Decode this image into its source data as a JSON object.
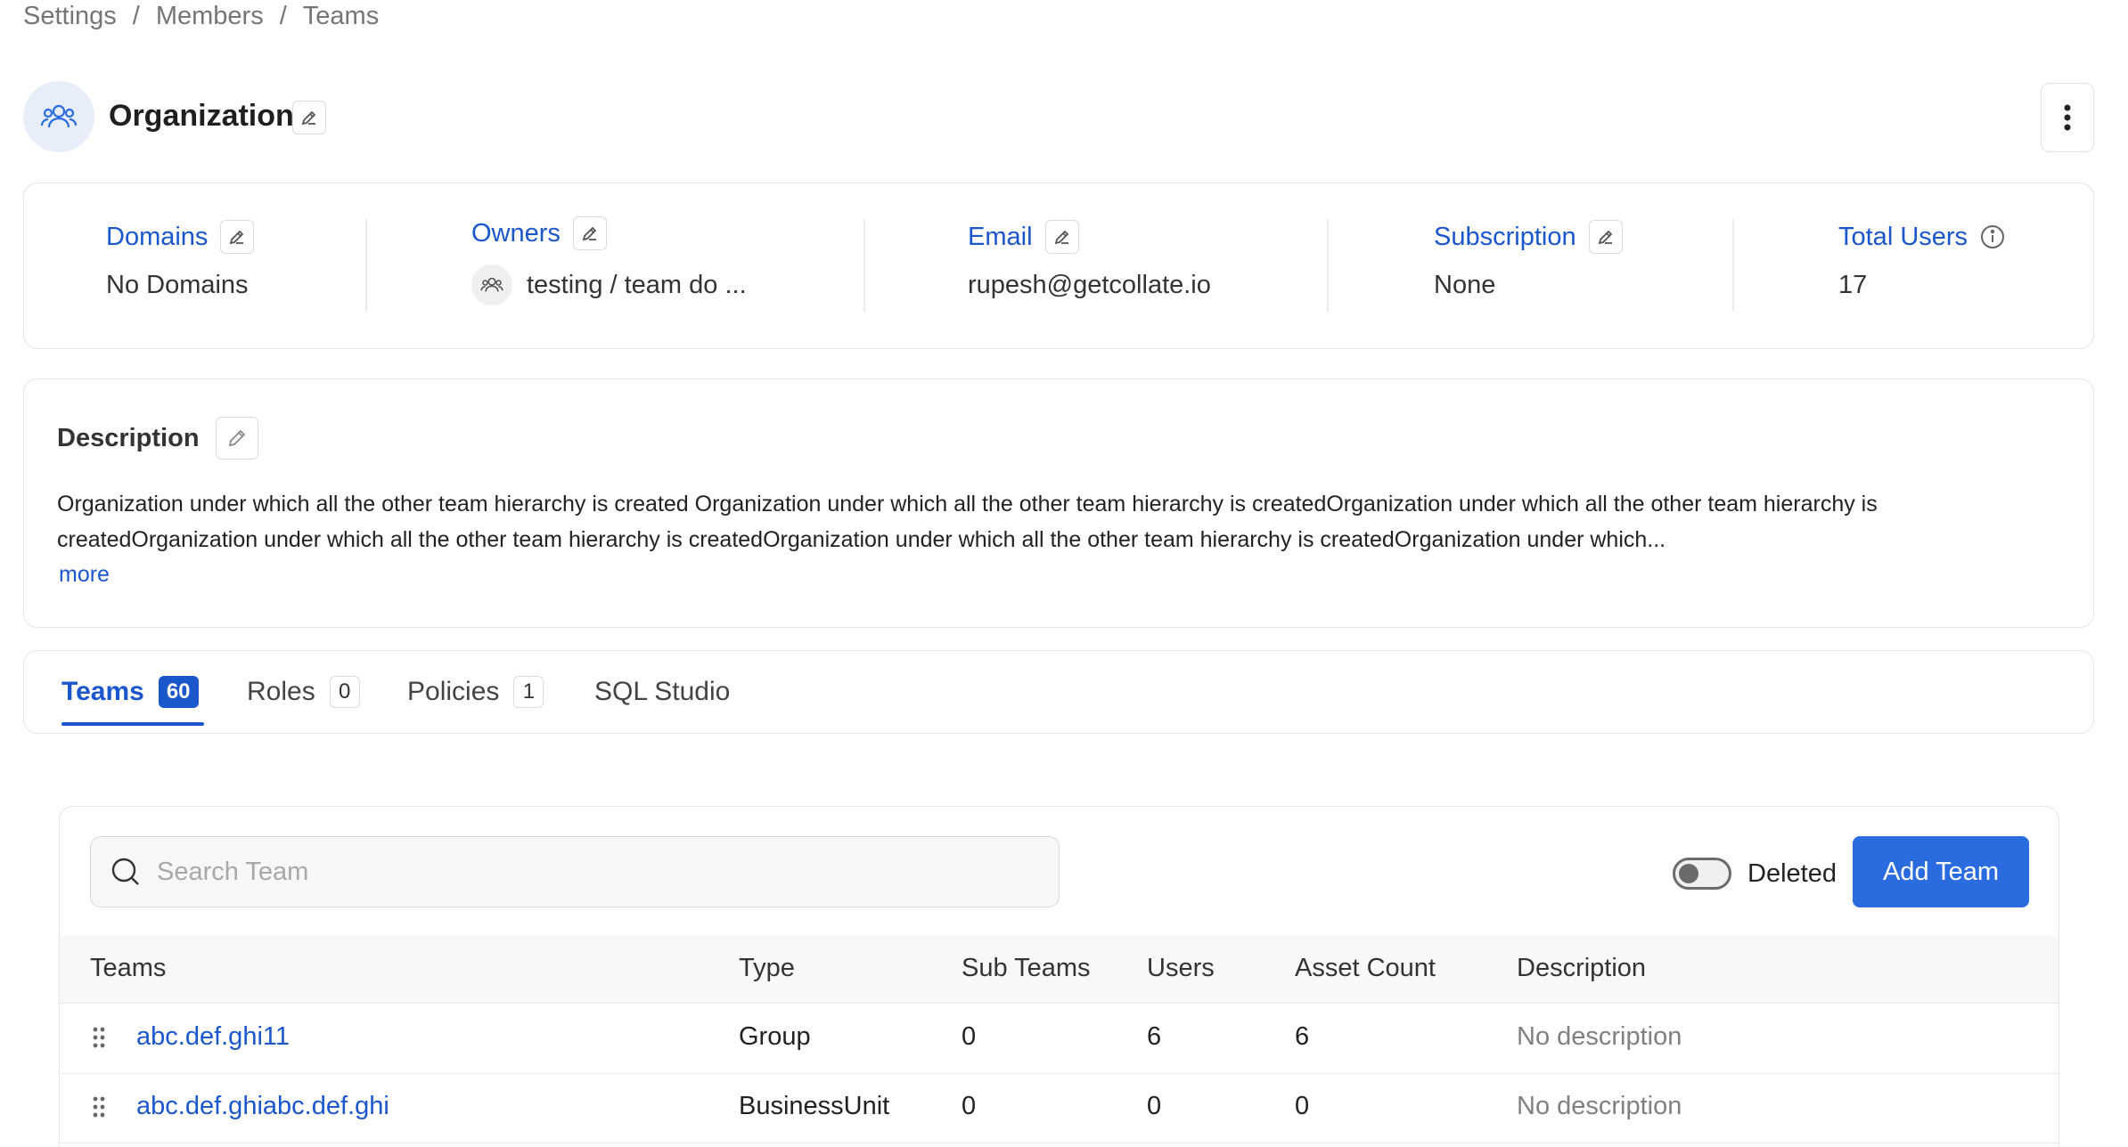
{
  "breadcrumb": [
    "Settings",
    "Members",
    "Teams"
  ],
  "header": {
    "title": "Organization"
  },
  "info": {
    "domains": {
      "label": "Domains",
      "value": "No Domains"
    },
    "owners": {
      "label": "Owners",
      "value": "testing / team do ..."
    },
    "email": {
      "label": "Email",
      "value": "rupesh@getcollate.io"
    },
    "subscription": {
      "label": "Subscription",
      "value": "None"
    },
    "total_users": {
      "label": "Total Users",
      "value": "17"
    }
  },
  "description": {
    "title": "Description",
    "text": "Organization under which all the other team hierarchy is created Organization under which all the other team hierarchy is createdOrganization under which all the other team hierarchy is createdOrganization under which all the other team hierarchy is createdOrganization under which all the other team hierarchy is createdOrganization under which...",
    "more": "more"
  },
  "tabs": [
    {
      "label": "Teams",
      "count": "60"
    },
    {
      "label": "Roles",
      "count": "0"
    },
    {
      "label": "Policies",
      "count": "1"
    },
    {
      "label": "SQL Studio",
      "count": ""
    }
  ],
  "toolbar": {
    "search_placeholder": "Search Team",
    "deleted_label": "Deleted",
    "add_label": "Add Team"
  },
  "table": {
    "columns": [
      "Teams",
      "Type",
      "Sub Teams",
      "Users",
      "Asset Count",
      "Description"
    ],
    "rows": [
      {
        "name": "abc.def.ghi11",
        "type": "Group",
        "sub_teams": "0",
        "users": "6",
        "asset_count": "6",
        "description": "No description"
      },
      {
        "name": "abc.def.ghiabc.def.ghi",
        "type": "BusinessUnit",
        "sub_teams": "0",
        "users": "0",
        "asset_count": "0",
        "description": "No description"
      }
    ]
  },
  "colors": {
    "accent": "#1a56cc",
    "button": "#2a6ce0"
  }
}
